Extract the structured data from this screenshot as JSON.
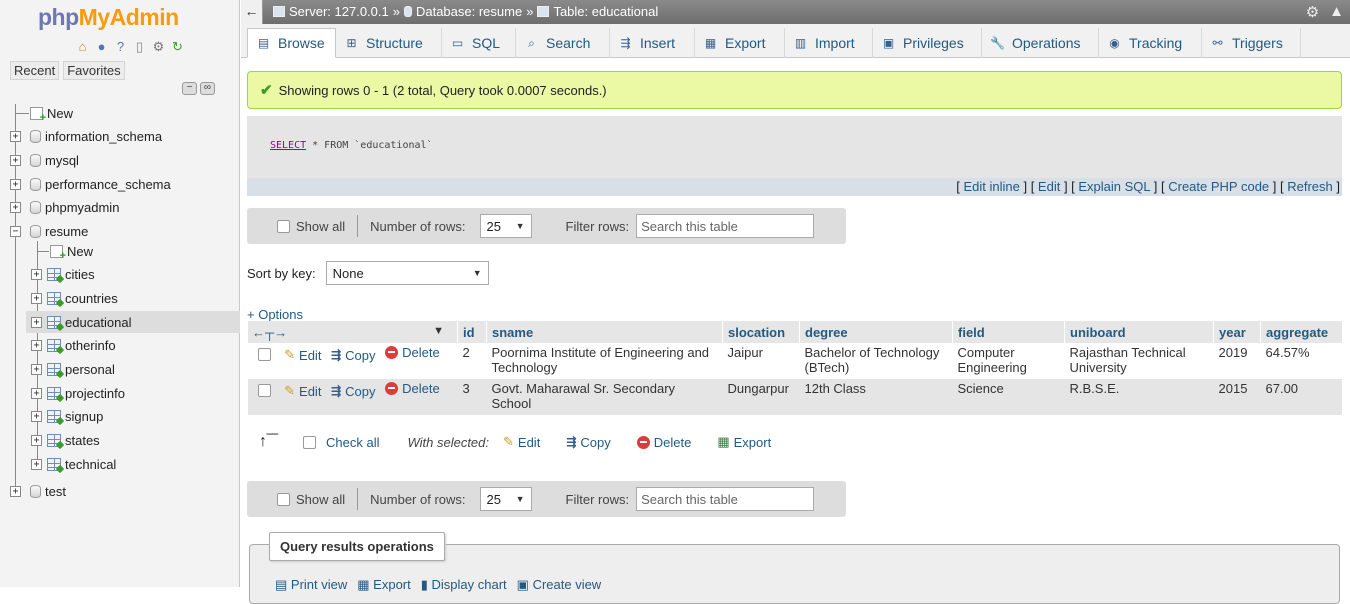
{
  "logo": {
    "part1": "php",
    "part2": "MyAdmin"
  },
  "nav_tabs": {
    "recent": "Recent",
    "favorites": "Favorites"
  },
  "tree": {
    "new_label": "New",
    "databases": [
      "information_schema",
      "mysql",
      "performance_schema",
      "phpmyadmin",
      "resume",
      "test"
    ],
    "resume_tables": [
      "cities",
      "countries",
      "educational",
      "otherinfo",
      "personal",
      "projectinfo",
      "signup",
      "states",
      "technical"
    ],
    "selected_table": "educational"
  },
  "breadcrumb": {
    "server": "Server: 127.0.0.1",
    "sep": "»",
    "database": "Database: resume",
    "table": "Table: educational"
  },
  "tabs": [
    "Browse",
    "Structure",
    "SQL",
    "Search",
    "Insert",
    "Export",
    "Import",
    "Privileges",
    "Operations",
    "Tracking",
    "Triggers"
  ],
  "active_tab": "Browse",
  "message": "Showing rows 0 - 1 (2 total, Query took 0.0007 seconds.)",
  "sql": {
    "keyword": "SELECT",
    "rest": " * FROM `educational`"
  },
  "sql_links": [
    "Edit inline",
    "Edit",
    "Explain SQL",
    "Create PHP code",
    "Refresh"
  ],
  "navbar": {
    "show_all": "Show all",
    "num_rows_label": "Number of rows:",
    "num_rows_value": "25",
    "filter_label": "Filter rows:",
    "filter_placeholder": "Search this table"
  },
  "sort": {
    "label": "Sort by key:",
    "value": "None"
  },
  "options_label": "+ Options",
  "table": {
    "columns": [
      "id",
      "sname",
      "slocation",
      "degree",
      "field",
      "uniboard",
      "year",
      "aggregate"
    ],
    "rows": [
      [
        "2",
        "Poornima Institute of Engineering and Technology",
        "Jaipur",
        "Bachelor of Technology (BTech)",
        "Computer Engineering",
        "Rajasthan Technical University",
        "2019",
        "64.57%"
      ],
      [
        "3",
        "Govt. Maharawal Sr. Secondary School",
        "Dungarpur",
        "12th Class",
        "Science",
        "R.B.S.E.",
        "2015",
        "67.00"
      ]
    ],
    "actions": {
      "edit": "Edit",
      "copy": "Copy",
      "delete": "Delete"
    }
  },
  "with_selected": {
    "check_all": "Check all",
    "label": "With selected:",
    "edit": "Edit",
    "copy": "Copy",
    "delete": "Delete",
    "export": "Export"
  },
  "query_ops": {
    "title": "Query results operations",
    "links": [
      "Print view",
      "Export",
      "Display chart",
      "Create view"
    ]
  }
}
